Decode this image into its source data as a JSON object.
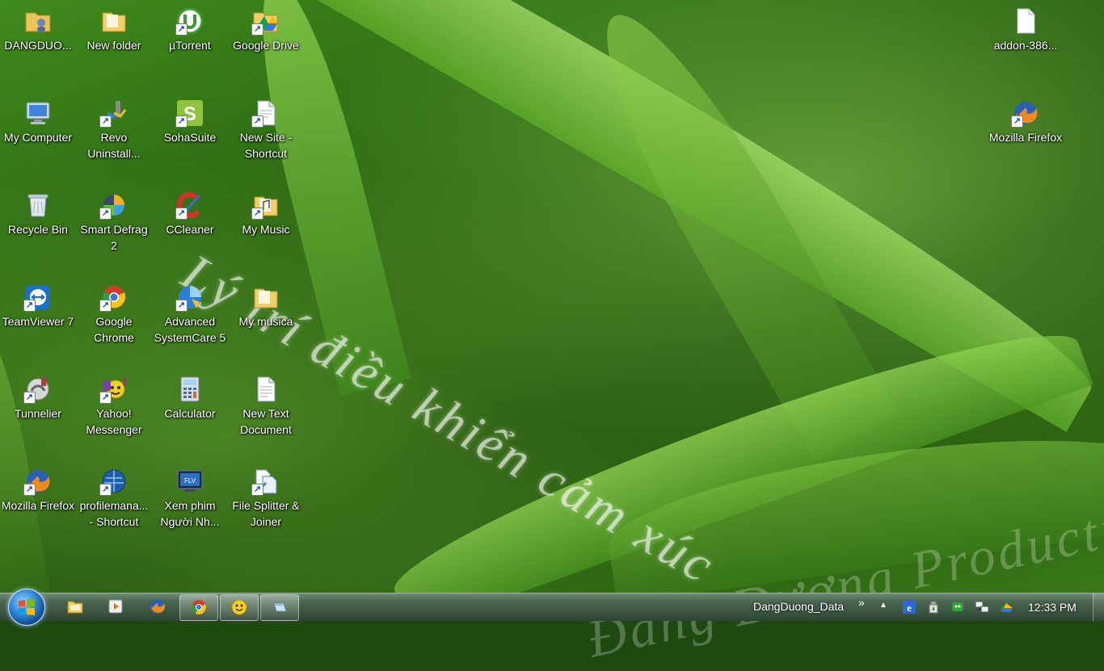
{
  "desktop": {
    "watermark_main": "Lý trí điều khiển cảm xúc",
    "watermark_secondary": "Đăng Dương Productions",
    "icons": [
      {
        "label": "DANGDUO...",
        "icon": "user-folder-icon"
      },
      {
        "label": "New folder",
        "icon": "folder-icon"
      },
      {
        "label": "µTorrent",
        "icon": "utorrent-icon"
      },
      {
        "label": "Google Drive",
        "icon": "google-drive-folder-icon"
      },
      {
        "label": "addon-386...",
        "icon": "file-icon"
      },
      {
        "label": "My Computer",
        "icon": "computer-icon"
      },
      {
        "label": "Revo Uninstall...",
        "icon": "revo-uninstaller-icon"
      },
      {
        "label": "SohaSuite",
        "icon": "sohasuite-icon"
      },
      {
        "label": "New Site - Shortcut",
        "icon": "web-document-icon"
      },
      {
        "label": "Mozilla Firefox",
        "icon": "firefox-icon"
      },
      {
        "label": "Recycle Bin",
        "icon": "recycle-bin-icon"
      },
      {
        "label": "Smart Defrag 2",
        "icon": "smart-defrag-icon"
      },
      {
        "label": "CCleaner",
        "icon": "ccleaner-icon"
      },
      {
        "label": "My Music",
        "icon": "music-folder-icon"
      },
      {
        "label": "TeamViewer 7",
        "icon": "teamviewer-icon"
      },
      {
        "label": "Google Chrome",
        "icon": "chrome-icon"
      },
      {
        "label": "Advanced SystemCare 5",
        "icon": "advanced-systemcare-icon"
      },
      {
        "label": "My musica",
        "icon": "folder-icon"
      },
      {
        "label": "Tunnelier",
        "icon": "tunnelier-icon"
      },
      {
        "label": "Yahoo! Messenger",
        "icon": "yahoo-messenger-icon"
      },
      {
        "label": "Calculator",
        "icon": "calculator-icon"
      },
      {
        "label": "New Text Document",
        "icon": "text-document-icon"
      },
      {
        "label": "Mozilla Firefox",
        "icon": "firefox-icon"
      },
      {
        "label": "profilemana... - Shortcut",
        "icon": "profile-manager-icon"
      },
      {
        "label": "Xem phim Người Nh...",
        "icon": "flv-player-icon"
      },
      {
        "label": "File Splitter & Joiner",
        "icon": "file-splitter-icon"
      }
    ]
  },
  "taskbar": {
    "start_button": "start-orb-icon",
    "pinned": [
      {
        "icon": "windows-explorer-icon",
        "active": false
      },
      {
        "icon": "media-player-icon",
        "active": false
      },
      {
        "icon": "firefox-icon",
        "active": false
      },
      {
        "icon": "chrome-icon",
        "active": true
      },
      {
        "icon": "yahoo-messenger-icon",
        "active": true
      },
      {
        "icon": "window-icon",
        "active": true
      }
    ],
    "toolbar_label": "DangDuong_Data",
    "toolbar_chevron": "»",
    "tray_expand": "▲",
    "clock": "12:33 PM"
  },
  "colors": {
    "taskbar_top": "#6f8a73",
    "taskbar_bottom": "#2c4632",
    "label_text": "#ffffff"
  }
}
